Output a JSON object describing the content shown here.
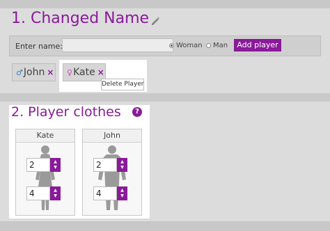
{
  "section1": {
    "title": "1. Changed Name",
    "enter_label": "Enter name:",
    "name_value": "",
    "gender_options": [
      "Woman",
      "Man"
    ],
    "gender_selected": "Woman",
    "add_button": "Add player",
    "players": [
      {
        "name": "John",
        "gender_symbol": "♂",
        "remove": "×"
      },
      {
        "name": "Kate",
        "gender_symbol": "♀",
        "remove": "×"
      }
    ],
    "tooltip": "Delete Player"
  },
  "section2": {
    "title": "2. Player clothes",
    "help": "?",
    "columns": [
      {
        "name": "Kate",
        "top_size": "2",
        "bottom_size": "4",
        "silhouette": "female-silhouette"
      },
      {
        "name": "John",
        "top_size": "2",
        "bottom_size": "4",
        "silhouette": "male-silhouette"
      }
    ]
  },
  "colors": {
    "accent": "#8a1a9a",
    "background": "#dcdcdc",
    "male": "#3a7fc4",
    "female": "#d04ab0"
  }
}
